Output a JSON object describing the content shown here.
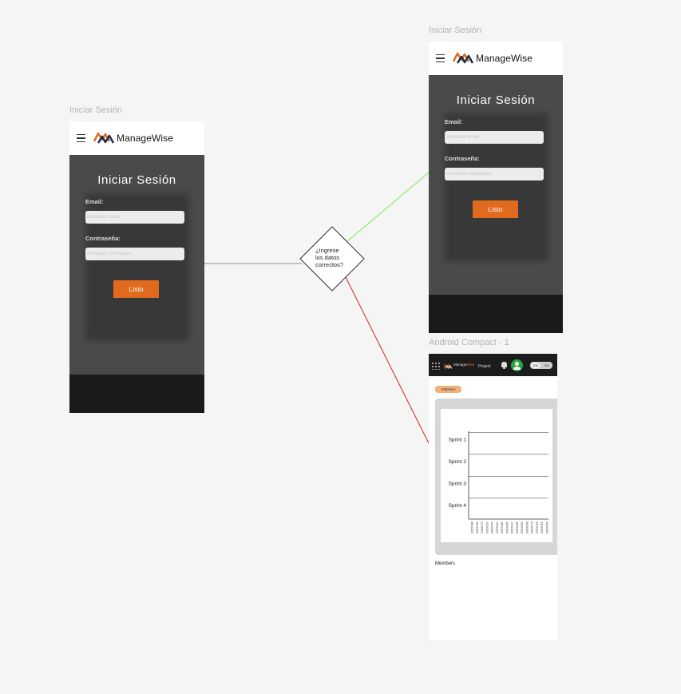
{
  "frames": {
    "login_a_label": "Iniciar Sesión",
    "login_b_label": "Iniciar Sesión",
    "android_label": "Android Compact - 1"
  },
  "login": {
    "brand": "ManageWise",
    "title": "Iniciar  Sesión",
    "email_label": "Email:",
    "email_placeholder": "introducir email",
    "password_label": "Contraseña:",
    "password_placeholder": "introducir contraseña",
    "submit_label": "Listo"
  },
  "decision": {
    "line1": "¿Ingrese",
    "line2": "los datos",
    "line3": "correctos?"
  },
  "colors": {
    "accent": "#e06a1e",
    "yes_connector": "#7be84a",
    "no_connector": "#e02020",
    "neutral_connector": "#8a8a8a"
  },
  "android": {
    "brand_prefix": "Manage",
    "brand_suffix": "Wise",
    "project_label": "Project",
    "lang_en": "EN",
    "lang_es": "ES",
    "statistics_label": "Statistics",
    "members_label": "Members",
    "icons": [
      "grid-icon",
      "bell-icon",
      "avatar-icon"
    ]
  },
  "chart_data": {
    "type": "line",
    "categories": [
      "Sprint  1",
      "Sprint  2",
      "Sprint  3",
      "Sprint  4"
    ],
    "x_ticks": [
      "09/10/23",
      "10/10/23",
      "11/10/23",
      "12/10/23",
      "13/10/23",
      "14/10/23",
      "15/10/23",
      "16/10/23",
      "17/10/23",
      "18/10/23",
      "19/10/23",
      "20/10/23",
      "21/10/23",
      "22/10/23",
      "23/10/23",
      "24/10/23"
    ]
  }
}
